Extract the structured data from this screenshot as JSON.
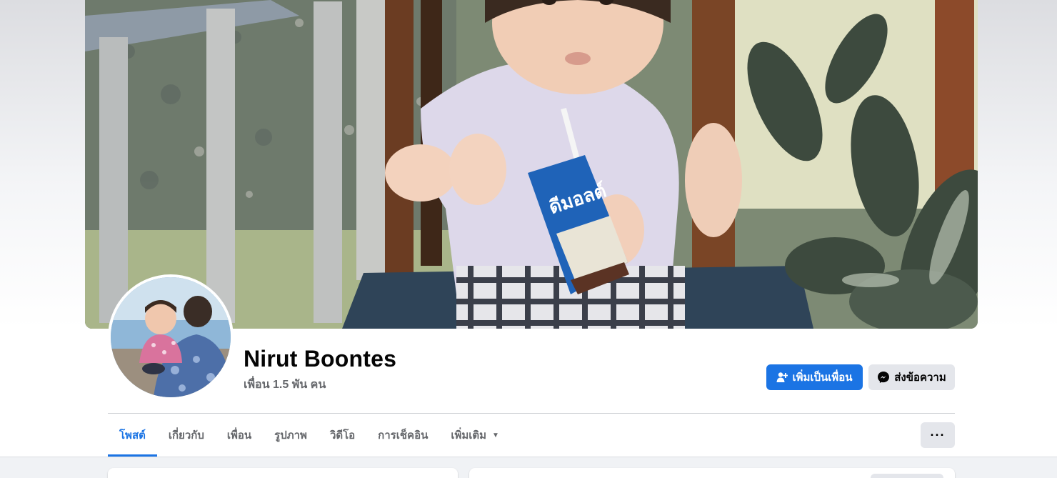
{
  "profile": {
    "name": "Nirut Boontes",
    "friends_count": "เพื่อน 1.5 พัน คน"
  },
  "actions": {
    "add_friend_label": "เพิ่มเป็นเพื่อน",
    "message_label": "ส่งข้อความ",
    "more_options_label": "···"
  },
  "tabs": [
    {
      "label": "โพสต์",
      "active": true
    },
    {
      "label": "เกี่ยวกับ",
      "active": false
    },
    {
      "label": "เพื่อน",
      "active": false
    },
    {
      "label": "รูปภาพ",
      "active": false
    },
    {
      "label": "วิดีโอ",
      "active": false
    },
    {
      "label": "การเช็คอิน",
      "active": false
    },
    {
      "label": "เพิ่มเติม",
      "active": false
    }
  ],
  "icons": {
    "add_friend": "person-plus-icon",
    "message": "messenger-icon",
    "more_tab": "caret-down-icon",
    "more_options": "ellipsis-icon"
  },
  "colors": {
    "accent": "#1b74e4",
    "secondary_button": "#e4e6eb",
    "muted_text": "#65676b",
    "page_background": "#f0f2f5"
  },
  "cover_photo": {
    "product_text": "ดีมอลต์"
  }
}
